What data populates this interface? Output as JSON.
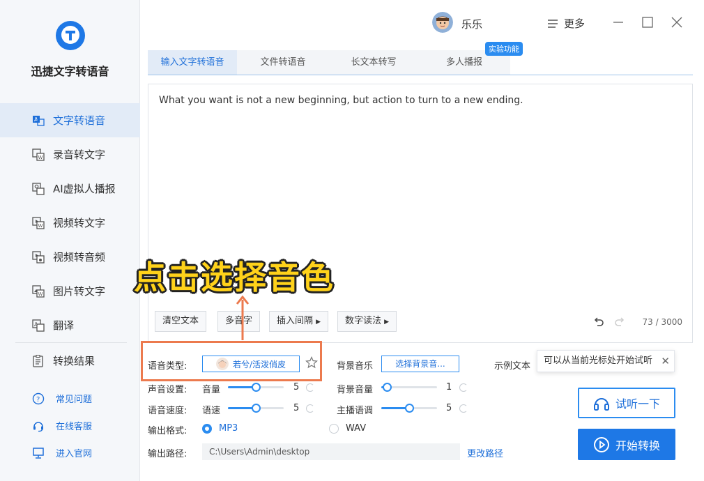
{
  "app": {
    "title": "迅捷文字转语音",
    "accent_color": "#1e78e6"
  },
  "sidebar": {
    "items": [
      {
        "label": "文字转语音",
        "icon": "text-to-speech-icon",
        "active": true
      },
      {
        "label": "录音转文字",
        "icon": "audio-to-text-icon"
      },
      {
        "label": "AI虚拟人播报",
        "icon": "ai-avatar-icon"
      },
      {
        "label": "视频转文字",
        "icon": "video-to-text-icon"
      },
      {
        "label": "视频转音频",
        "icon": "video-to-audio-icon"
      },
      {
        "label": "图片转文字",
        "icon": "image-to-text-icon"
      },
      {
        "label": "翻译",
        "icon": "translate-icon"
      }
    ],
    "result": {
      "label": "转换结果",
      "icon": "results-icon"
    },
    "links": [
      {
        "label": "常见问题",
        "icon": "help-icon"
      },
      {
        "label": "在线客服",
        "icon": "headset-icon"
      },
      {
        "label": "进入官网",
        "icon": "monitor-icon"
      }
    ]
  },
  "header": {
    "username": "乐乐",
    "more_label": "更多"
  },
  "tabs": [
    {
      "label": "输入文字转语音",
      "active": true
    },
    {
      "label": "文件转语音"
    },
    {
      "label": "长文本转写"
    },
    {
      "label": "多人播报"
    }
  ],
  "experimental_badge": "实验功能",
  "editor": {
    "text": "What you want is not a new beginning, but action to turn to a new ending.",
    "buttons": {
      "clear": "清空文本",
      "polyphone": "多音字",
      "insert_pause": "插入间隔",
      "number_reading": "数字读法"
    },
    "counter": "73 / 3000"
  },
  "annotation": "点击选择音色",
  "settings": {
    "voice_type_label": "语音类型:",
    "voice_name": "若兮/活泼俏皮",
    "bgm_label": "背景音乐",
    "bgm_button": "选择背景音...",
    "sample_text_label": "示例文本",
    "sound_settings_label": "声音设置:",
    "volume_label": "音量",
    "volume_value": 5,
    "bg_volume_label": "背景音量",
    "bg_volume_value": 1,
    "speed_label": "语音速度:",
    "speed_sub_label": "语速",
    "speed_value": 5,
    "pitch_label": "主播语调",
    "pitch_value": 5,
    "slider_max": 10,
    "format_label": "输出格式:",
    "format_options": [
      "MP3",
      "WAV"
    ],
    "format_selected": "MP3",
    "path_label": "输出路径:",
    "path_value": "C:\\Users\\Admin\\desktop",
    "change_path": "更改路径"
  },
  "tooltip": "可以从当前光标处开始试听",
  "actions": {
    "preview": "试听一下",
    "start": "开始转换"
  }
}
